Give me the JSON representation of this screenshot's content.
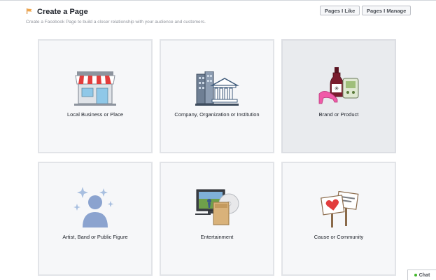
{
  "header": {
    "title": "Create a Page",
    "subtitle": "Create a Facebook Page to build a closer relationship with your audience and customers."
  },
  "buttons": {
    "pages_i_like": "Pages I Like",
    "pages_i_manage": "Pages I Manage"
  },
  "categories": [
    {
      "label": "Local Business or Place",
      "icon": "storefront-icon"
    },
    {
      "label": "Company, Organization or Institution",
      "icon": "buildings-icon"
    },
    {
      "label": "Brand or Product",
      "icon": "products-icon"
    },
    {
      "label": "Artist, Band or Public Figure",
      "icon": "star-person-icon"
    },
    {
      "label": "Entertainment",
      "icon": "media-icon"
    },
    {
      "label": "Cause or Community",
      "icon": "protest-signs-icon"
    }
  ],
  "chat": {
    "label": "Chat",
    "status_color": "#42b72a"
  },
  "colors": {
    "accent": "#3b5998",
    "tile_bg": "#f6f7f9",
    "tile_hover_bg": "#e9ebee"
  }
}
